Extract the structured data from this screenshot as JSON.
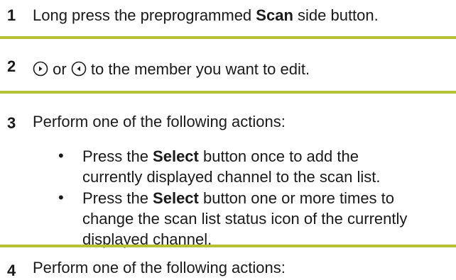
{
  "steps": [
    {
      "number": "1",
      "text_before": "Long press the preprogrammed ",
      "bold": "Scan",
      "text_after": " side button."
    },
    {
      "number": "2",
      "icon_left": "right-arrow-key-icon",
      "connector": " or ",
      "icon_right": "left-arrow-key-icon",
      "text": " to the member you want to edit."
    },
    {
      "number": "3",
      "text": "Perform one of the following actions:",
      "bullets": [
        {
          "prefix": "Press the ",
          "bold": "Select",
          "line1_rest": " button once to add the",
          "line2": "currently displayed channel to the scan list."
        },
        {
          "prefix": "Press the ",
          "bold": "Select",
          "line1_rest": " button one or more times to",
          "line2": "change the scan list status icon of the currently",
          "line3": "displayed channel."
        }
      ]
    },
    {
      "number": "4",
      "text": "Perform one of the following actions:"
    }
  ],
  "colors": {
    "rule": "#b5c234",
    "text": "#1a1a1a"
  }
}
